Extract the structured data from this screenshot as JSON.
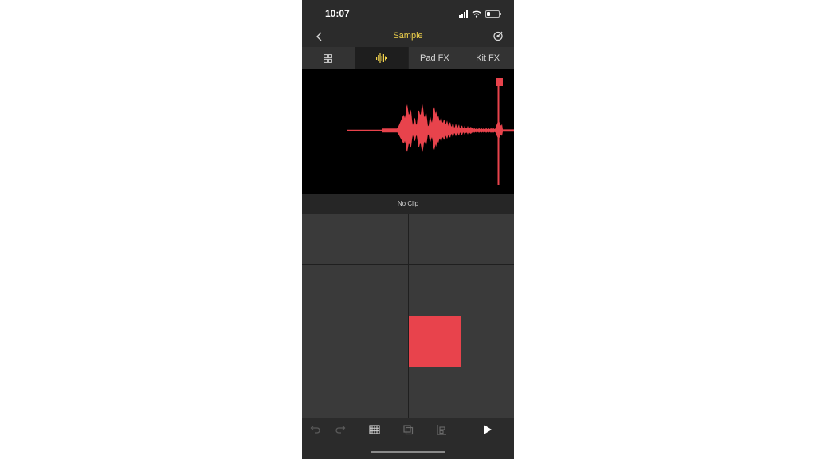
{
  "status_bar": {
    "time": "10:07",
    "icons": [
      "cellular-signal-icon",
      "wifi-icon",
      "battery-icon"
    ]
  },
  "nav": {
    "title": "Sample",
    "back_icon": "chevron-left-icon",
    "right_icon": "tuner-icon"
  },
  "tabs": [
    {
      "icon": "grid-icon",
      "label": "",
      "active": false
    },
    {
      "icon": "waveform-icon",
      "label": "",
      "active": true
    },
    {
      "label": "Pad FX",
      "active": false
    },
    {
      "label": "Kit FX",
      "active": false
    }
  ],
  "waveform": {
    "color": "#e8434c",
    "background": "#000000"
  },
  "clip_label": "No Clip",
  "pads": {
    "rows": 4,
    "cols": 4,
    "active_index": 10,
    "active_color": "#e8434c"
  },
  "toolbar": {
    "icons": [
      "undo-icon",
      "redo-icon",
      "pad-grid-icon",
      "duplicate-icon",
      "align-icon",
      "play-icon"
    ]
  },
  "colors": {
    "accent_yellow": "#f0d24c",
    "pad_active": "#e8434c",
    "background": "#2b2b2b"
  }
}
